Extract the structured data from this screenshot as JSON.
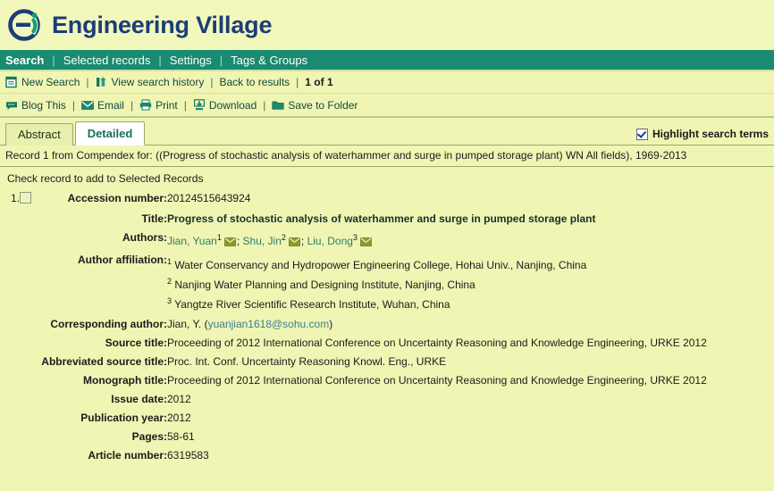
{
  "brand": {
    "title": "Engineering Village",
    "logo_icon": "ei-logo-icon",
    "logo_color_ring": "#1b3d78",
    "logo_color_accent": "#12a17a"
  },
  "nav": {
    "bar_color": "#1a8a71",
    "items": [
      {
        "label": "Search",
        "active": true
      },
      {
        "label": "Selected records",
        "active": false
      },
      {
        "label": "Settings",
        "active": false
      },
      {
        "label": "Tags & Groups",
        "active": false
      }
    ],
    "separator": "|"
  },
  "actionbar": {
    "items": [
      {
        "label": "New Search",
        "icon": "new-search-icon"
      },
      {
        "label": "View search history",
        "icon": "search-history-icon"
      },
      {
        "label": "Back to results",
        "icon": ""
      }
    ],
    "page_indicator": "1 of 1",
    "separator": "|"
  },
  "toolbar": {
    "items": [
      {
        "label": "Blog This",
        "icon": "blog-icon"
      },
      {
        "label": "Email",
        "icon": "email-icon"
      },
      {
        "label": "Print",
        "icon": "print-icon"
      },
      {
        "label": "Download",
        "icon": "download-icon"
      },
      {
        "label": "Save to Folder",
        "icon": "folder-icon"
      }
    ],
    "separator": "|"
  },
  "tabs": [
    {
      "label": "Abstract",
      "active": false
    },
    {
      "label": "Detailed",
      "active": true
    }
  ],
  "highlight": {
    "label": "Highlight search terms",
    "checked": true
  },
  "record_banner": "Record 1 from Compendex for: ((Progress of stochastic analysis of waterhammer and surge in pumped storage plant) WN All fields), 1969-2013",
  "check_note": "Check record to add to Selected Records",
  "record": {
    "number": "1.",
    "checked": false,
    "accession_label": "Accession number:",
    "accession_value": "20124515643924",
    "title_label": "Title:",
    "title_value": "Progress of stochastic analysis of waterhammer and surge in pumped storage plant",
    "authors_label": "Authors:",
    "authors": [
      {
        "name": "Jian, Yuan",
        "sup": "1"
      },
      {
        "name": "Shu, Jin",
        "sup": "2"
      },
      {
        "name": "Liu, Dong",
        "sup": "3"
      }
    ],
    "authors_sep": "; ",
    "affiliation_label": "Author affiliation:",
    "affiliations": [
      {
        "sup": "1",
        "text": "Water Conservancy and Hydropower Engineering College, Hohai Univ., Nanjing, China"
      },
      {
        "sup": "2",
        "text": "Nanjing Water Planning and Designing Institute, Nanjing, China"
      },
      {
        "sup": "3",
        "text": "Yangtze River Scientific Research Institute, Wuhan, China"
      }
    ],
    "corresponding_label": "Corresponding author:",
    "corresponding_name": "Jian, Y. (",
    "corresponding_email": "yuanjian1618@sohu.com",
    "corresponding_close": ")",
    "rows": [
      {
        "label": "Source title:",
        "value": "Proceeding of 2012 International Conference on Uncertainty Reasoning and Knowledge Engineering, URKE 2012"
      },
      {
        "label": "Abbreviated source title:",
        "value": "Proc. Int. Conf. Uncertainty Reasoning Knowl. Eng., URKE"
      },
      {
        "label": "Monograph title:",
        "value": "Proceeding of 2012 International Conference on Uncertainty Reasoning and Knowledge Engineering, URKE 2012"
      },
      {
        "label": "Issue date:",
        "value": "2012"
      },
      {
        "label": "Publication year:",
        "value": "2012"
      },
      {
        "label": "Pages:",
        "value": "58-61"
      },
      {
        "label": "Article number:",
        "value": "6319583"
      }
    ]
  },
  "colors": {
    "page_bg": "#f0f5b4",
    "nav_bg": "#1a8a71",
    "link": "#2e7d63",
    "active_tab_text": "#14705c"
  }
}
